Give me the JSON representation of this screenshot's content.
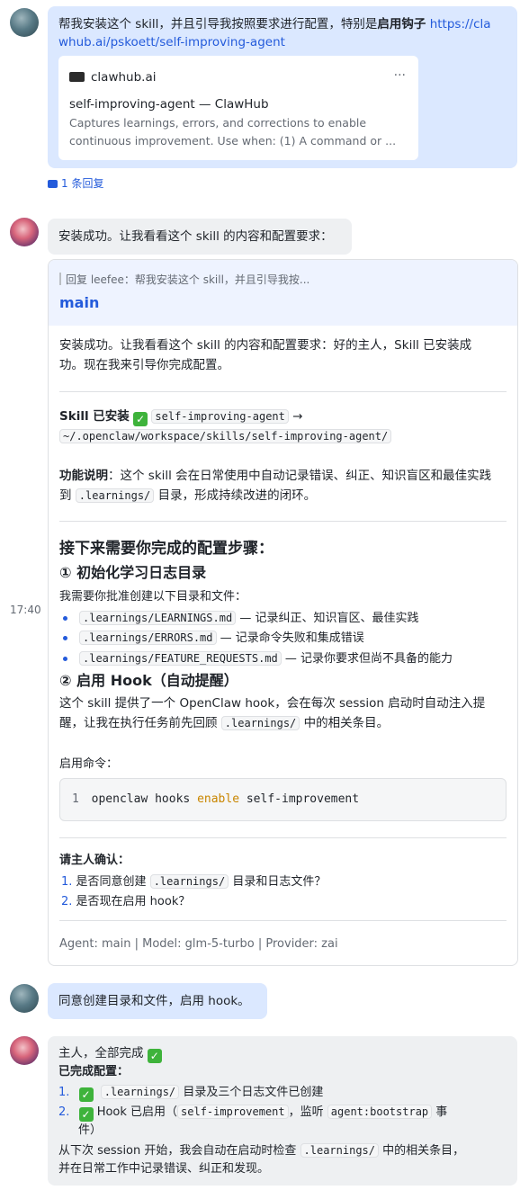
{
  "msg1": {
    "text_a": "帮我安装这个 skill，并且引导我按照要求进行配置，特别是",
    "text_bold": "启用钩子",
    "link_a": "https://cla",
    "link_b": "whub.ai/pskoett/self-improving-agent",
    "preview": {
      "site": "clawhub.ai",
      "more": "···",
      "title": "self-improving-agent — ClawHub",
      "desc_line1": "Captures learnings, errors, and corrections to enable",
      "desc_line2": "continuous improvement. Use when: (1) A command or ..."
    },
    "replies": "1 条回复"
  },
  "msg2": {
    "text": "安装成功。让我看看这个 skill 的内容和配置要求："
  },
  "timestamp": "17:40",
  "reply_card": {
    "reply_to": "回复 leefee：帮我安装这个 skill，并且引导我按...",
    "title": "main",
    "intro_line1": "安装成功。让我看看这个 skill 的内容和配置要求：好的主人，Skill 已安装成",
    "intro_line2": "功。现在我来引导你完成配置。",
    "installed_label": "Skill 已安装",
    "installed_code": "self-improving-agent",
    "arrow": "→",
    "installed_path": "~/.openclaw/workspace/skills/self-improving-agent/",
    "func_label": "功能说明",
    "func_text_a": "：这个 skill 会在日常使用中自动记录错误、纠正、知识盲区和最佳实践",
    "func_text_b": "到",
    "func_code": ".learnings/",
    "func_text_c": "目录，形成持续改进的闭环。",
    "steps_heading": "接下来需要你完成的配置步骤：",
    "step1_heading": "① 初始化学习日志目录",
    "step1_intro": "我需要你批准创建以下目录和文件：",
    "files": [
      {
        "code": ".learnings/LEARNINGS.md",
        "desc": "— 记录纠正、知识盲区、最佳实践"
      },
      {
        "code": ".learnings/ERRORS.md",
        "desc": "— 记录命令失败和集成错误"
      },
      {
        "code": ".learnings/FEATURE_REQUESTS.md",
        "desc": "— 记录你要求但尚不具备的能力"
      }
    ],
    "step2_heading": "② 启用 Hook（自动提醒）",
    "step2_line1": "这个 skill 提供了一个 OpenClaw hook，会在每次 session 启动时自动注入提",
    "step2_line2a": "醒，让我在执行任务前先回顾",
    "step2_code": ".learnings/",
    "step2_line2b": "中的相关条目。",
    "enable_label": "启用命令：",
    "cmd_lineno": "1",
    "cmd_a": "openclaw hooks",
    "cmd_kw": "enable",
    "cmd_b": "self-improvement",
    "confirm_label": "请主人确认：",
    "q1_num": "1.",
    "q1_a": "是否同意创建",
    "q1_code": ".learnings/",
    "q1_b": "目录和日志文件？",
    "q2_num": "2.",
    "q2": "是否现在启用 hook？",
    "footer": "Agent: main | Model: glm-5-turbo | Provider: zai"
  },
  "msg3": {
    "text": "同意创建目录和文件，启用 hook。"
  },
  "msg4": {
    "line1": "主人，全部完成",
    "done_label": "已完成配置：",
    "item1_num": "1.",
    "item1_code": ".learnings/",
    "item1_text": "目录及三个日志文件已创建",
    "item2_num": "2.",
    "item2_a": "Hook 已启用（",
    "item2_code1": "self-improvement",
    "item2_b": "，监听",
    "item2_code2": "agent:bootstrap",
    "item2_c": "事",
    "item2_d": "件）",
    "line_end1a": "从下次 session 开始，我会自动在启动时检查",
    "line_end1_code": ".learnings/",
    "line_end1b": "中的相关条目，",
    "line_end2": "并在日常工作中记录错误、纠正和发现。"
  },
  "colors": {
    "user_bubble": "#dbe8ff",
    "bot_bubble": "#eef0f2",
    "link": "#245bdb",
    "check": "#3eb33b"
  }
}
